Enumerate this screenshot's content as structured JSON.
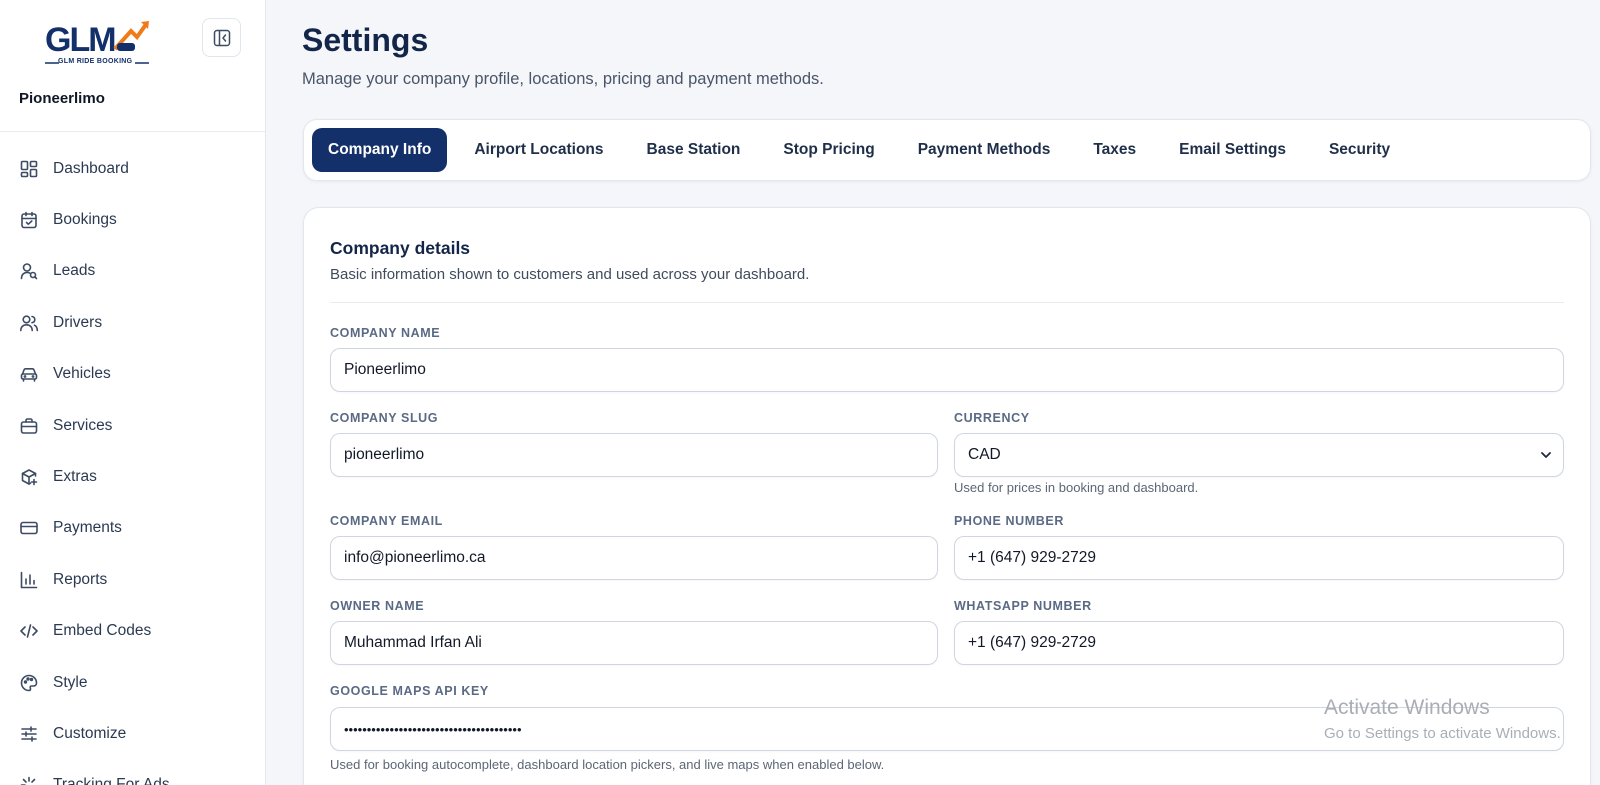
{
  "sidebar": {
    "logo_text": "GLM",
    "logo_subtext": "GLM RIDE BOOKING",
    "company_name": "Pioneerlimo",
    "items": [
      {
        "label": "Dashboard",
        "icon": "dashboard-icon"
      },
      {
        "label": "Bookings",
        "icon": "calendar-icon"
      },
      {
        "label": "Leads",
        "icon": "user-search-icon"
      },
      {
        "label": "Drivers",
        "icon": "users-icon"
      },
      {
        "label": "Vehicles",
        "icon": "car-icon"
      },
      {
        "label": "Services",
        "icon": "briefcase-icon"
      },
      {
        "label": "Extras",
        "icon": "package-plus-icon"
      },
      {
        "label": "Payments",
        "icon": "credit-card-icon"
      },
      {
        "label": "Reports",
        "icon": "bar-chart-icon"
      },
      {
        "label": "Embed Codes",
        "icon": "code-icon"
      },
      {
        "label": "Style",
        "icon": "palette-icon"
      },
      {
        "label": "Customize",
        "icon": "sliders-icon"
      },
      {
        "label": "Tracking For Ads",
        "icon": "sparkle-icon"
      }
    ]
  },
  "header": {
    "title": "Settings",
    "subtitle": "Manage your company profile, locations, pricing and payment methods."
  },
  "tabs": [
    {
      "label": "Company Info",
      "active": true
    },
    {
      "label": "Airport Locations",
      "active": false
    },
    {
      "label": "Base Station",
      "active": false
    },
    {
      "label": "Stop Pricing",
      "active": false
    },
    {
      "label": "Payment Methods",
      "active": false
    },
    {
      "label": "Taxes",
      "active": false
    },
    {
      "label": "Email Settings",
      "active": false
    },
    {
      "label": "Security",
      "active": false
    }
  ],
  "company_details": {
    "title": "Company details",
    "description": "Basic information shown to customers and used across your dashboard.",
    "company_name": {
      "label": "COMPANY NAME",
      "value": "Pioneerlimo"
    },
    "company_slug": {
      "label": "COMPANY SLUG",
      "value": "pioneerlimo"
    },
    "currency": {
      "label": "CURRENCY",
      "value": "CAD",
      "help": "Used for prices in booking and dashboard."
    },
    "company_email": {
      "label": "COMPANY EMAIL",
      "value": "info@pioneerlimo.ca"
    },
    "phone_number": {
      "label": "PHONE NUMBER",
      "value": "+1 (647) 929-2729"
    },
    "owner_name": {
      "label": "OWNER NAME",
      "value": "Muhammad Irfan Ali"
    },
    "whatsapp_number": {
      "label": "WHATSAPP NUMBER",
      "value": "+1 (647) 929-2729"
    },
    "google_maps_api_key": {
      "label": "GOOGLE MAPS API KEY",
      "value": "•••••••••••••••••••••••••••••••••••••••",
      "help": "Used for booking autocomplete, dashboard location pickers, and live maps when enabled below."
    }
  },
  "watermark": {
    "line1": "Activate Windows",
    "line2": "Go to Settings to activate Windows."
  },
  "colors": {
    "primary": "#13306a",
    "accent_orange": "#f07a1a"
  }
}
